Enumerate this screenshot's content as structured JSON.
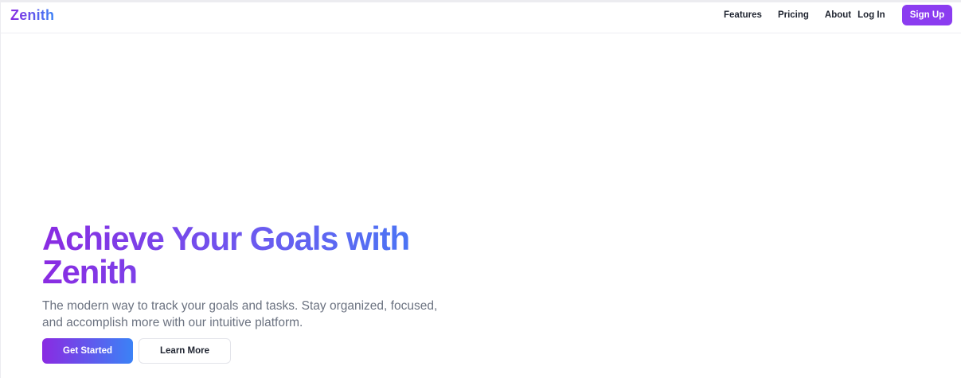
{
  "header": {
    "brand": "Zenith",
    "nav": {
      "features": "Features",
      "pricing": "Pricing",
      "about": "About",
      "login": "Log In",
      "signup": "Sign Up"
    }
  },
  "hero": {
    "title": "Achieve Your Goals with Zenith",
    "subtitle": "The modern way to track your goals and tasks. Stay organized, focused, and accomplish more with our intuitive platform.",
    "primary_cta": "Get Started",
    "secondary_cta": "Learn More"
  },
  "colors": {
    "brand_purple": "#8a2be2",
    "brand_blue": "#3b82f6",
    "signup_bg": "#8b3cf0",
    "text_dark": "#1f2430",
    "text_muted": "#6b7280"
  }
}
